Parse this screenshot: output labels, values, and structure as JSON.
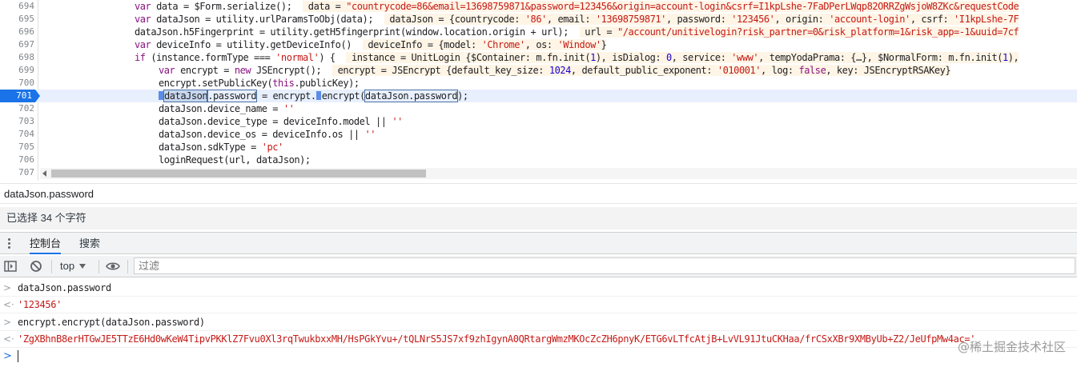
{
  "editor": {
    "lines": [
      {
        "num": "694",
        "indent": 168,
        "html": "<span class=\"kw\">var</span> data = $Form.serialize();  <span class=\"inl\"> data = <span class=\"str\">\"countrycode=86&amp;email=13698759871&amp;password=123456&amp;origin=account-login&amp;csrf=I1kpLshe-7FaDPerLWqp82ORRZgWsjoW8ZKc&amp;requestCode</span></span>"
      },
      {
        "num": "695",
        "indent": 168,
        "html": "<span class=\"kw\">var</span> dataJson = utility.urlParamsToObj(data);  <span class=\"inl\"> dataJson = {countrycode: <span class=\"str\">'86'</span>, email: <span class=\"str\">'13698759871'</span>, password: <span class=\"str\">'123456'</span>, origin: <span class=\"str\">'account-login'</span>, csrf: <span class=\"str\">'I1kpLshe-7F</span></span>"
      },
      {
        "num": "696",
        "indent": 168,
        "html": "dataJson.h5Fingerprint = utility.getH5fingerprint(window.location.origin + url);  <span class=\"inl\"> url = <span class=\"str\">\"/account/unitivelogin?risk_partner=0&amp;risk_platform=1&amp;risk_app=-1&amp;uuid=7cf</span></span>"
      },
      {
        "num": "697",
        "indent": 168,
        "html": "<span class=\"kw\">var</span> deviceInfo = utility.getDeviceInfo()  <span class=\"inl\"> deviceInfo = {model: <span class=\"str\">'Chrome'</span>, os: <span class=\"str\">'Window'</span>}</span>"
      },
      {
        "num": "698",
        "indent": 168,
        "html": "<span class=\"kw\">if</span> (instance.formType === <span class=\"str\">'normal'</span>) {  <span class=\"inl\"> instance = UnitLogin {$Container: m.fn.init(<span class=\"num\">1</span>), isDialog: <span class=\"num\">0</span>, service: <span class=\"str\">'www'</span>, tempYodaPrama: {…}, $NormalForm: m.fn.init(<span class=\"num\">1</span>),</span>"
      },
      {
        "num": "699",
        "indent": 198,
        "html": "<span class=\"kw\">var</span> encrypt = <span class=\"kw\">new</span> JSEncrypt();  <span class=\"inl\"> encrypt = JSEncrypt {default_key_size: <span class=\"num\">1024</span>, default_public_exponent: <span class=\"str\">'010001'</span>, log: <span class=\"kw\">false</span>, key: JSEncryptRSAKey}</span>"
      },
      {
        "num": "700",
        "indent": 198,
        "html": "encrypt.setPublicKey(<span class=\"kw\">this</span>.publicKey);"
      },
      {
        "num": "701",
        "indent": 198,
        "paused": true,
        "html": "<span class=\"marker\"></span><span class=\"hlbox\">dataJson</span><span class=\"hlbox2\">.password</span> = encrypt.<span class=\"marker\"></span>encrypt(<span class=\"hlbox2\">dataJson.password</span>);"
      },
      {
        "num": "702",
        "indent": 198,
        "html": "dataJson.device_name = <span class=\"str\">''</span>"
      },
      {
        "num": "703",
        "indent": 198,
        "html": "dataJson.device_type = deviceInfo.model || <span class=\"str\">''</span>"
      },
      {
        "num": "704",
        "indent": 198,
        "html": "dataJson.device_os = deviceInfo.os || <span class=\"str\">''</span>"
      },
      {
        "num": "705",
        "indent": 198,
        "html": "dataJson.sdkType = <span class=\"str\">'pc'</span>"
      },
      {
        "num": "706",
        "indent": 198,
        "html": "loginRequest(url, dataJson);"
      },
      {
        "num": "707",
        "indent": 168,
        "html": ""
      }
    ]
  },
  "expression_bar": {
    "text": "dataJson.password"
  },
  "selection_status": {
    "text": "已选择 34 个字符"
  },
  "drawer": {
    "tabs": [
      {
        "label": "控制台",
        "active": true
      },
      {
        "label": "搜索",
        "active": false
      }
    ]
  },
  "console_toolbar": {
    "context": "top",
    "filter_placeholder": "过滤"
  },
  "console": {
    "messages": [
      {
        "prefix": ">",
        "text": "dataJson.password",
        "result": false
      },
      {
        "prefix": "<·",
        "text": "'123456'",
        "result": true
      },
      {
        "prefix": ">",
        "text": "encrypt.encrypt(dataJson.password)",
        "result": false
      },
      {
        "prefix": "<·",
        "text": "'ZgXBhnB8erHTGwJE5TTzE6Hd0wKeW4TipvPKKlZ7Fvu0Xl3rqTwukbxxMH/HsPGkYvu+/tQLNrS5JS7xf9zhIgynA0QRtargWmzMKOcZcZH6pnyK/ETG6vLTfcAtjB+LvVL91JtuCKHaa/frCSxXBr9XMByUb+Z2/JeUfpMw4ac='",
        "result": true
      }
    ],
    "prompt": ">"
  },
  "watermark": {
    "text": "@稀土掘金技术社区"
  },
  "colors": {
    "accent": "#1a73e8",
    "string": "#c41a16",
    "keyword": "#881280",
    "number": "#1c00cf"
  }
}
